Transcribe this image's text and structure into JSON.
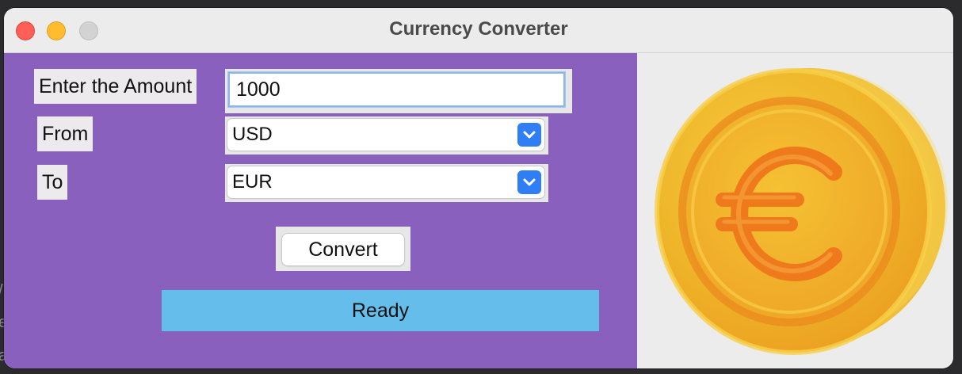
{
  "window": {
    "title": "Currency Converter"
  },
  "form": {
    "amount_label": "Enter the Amount",
    "amount_value": "1000",
    "from_label": "From",
    "from_value": "USD",
    "to_label": "To",
    "to_value": "EUR",
    "convert_label": "Convert",
    "status_text": "Ready"
  },
  "image": {
    "icon": "euro-coin-icon",
    "symbol": "€"
  },
  "colors": {
    "panel_bg": "#8a60bf",
    "status_bg": "#64bdea",
    "select_arrow": "#2f7ef6",
    "coin_gold": "#f2c233",
    "coin_orange": "#ee7a1c"
  }
}
